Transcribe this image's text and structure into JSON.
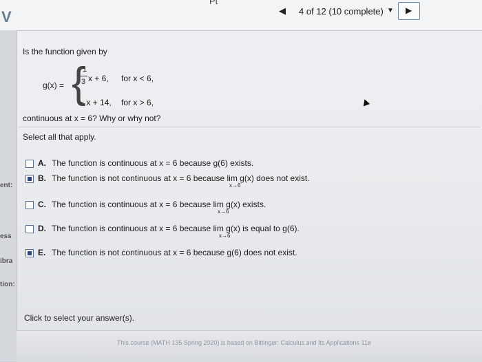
{
  "header": {
    "top_fragment": "Pt",
    "progress": "4 of 12 (10 complete)",
    "prev_icon": "triangle-left",
    "next_icon": "triangle-right",
    "caret_icon": "triangle-down"
  },
  "sidebar_fragments": [
    "ent:",
    "ess",
    "ibra",
    "tion:"
  ],
  "question": {
    "intro": "Is the function given by",
    "g_label": "g(x) =",
    "frac_num": "1",
    "frac_den": "3",
    "piece1_expr": "x + 6,",
    "piece1_cond": "for x < 6,",
    "piece2_expr": "− x + 14,",
    "piece2_cond": "for x > 6,",
    "outro": "continuous at x = 6? Why or why not?",
    "instruction": "Select all that apply."
  },
  "options": [
    {
      "letter": "A.",
      "text": "The function is continuous at x = 6 because g(6) exists.",
      "checked": false,
      "sub": ""
    },
    {
      "letter": "B.",
      "text": "The function is not continuous at x = 6 because  lim g(x) does not exist.",
      "checked": true,
      "sub": "x→6"
    },
    {
      "letter": "C.",
      "text": "The function is continuous at x = 6 because  lim g(x) exists.",
      "checked": false,
      "sub": "x→6"
    },
    {
      "letter": "D.",
      "text": "The function is continuous at x = 6 because  lim g(x) is equal to g(6).",
      "checked": false,
      "sub": "x→6"
    },
    {
      "letter": "E.",
      "text": "The function is not continuous at x = 6 because g(6) does not exist.",
      "checked": true,
      "sub": ""
    }
  ],
  "footer": {
    "select_answer": "Click to select your answer(s).",
    "course_note": "This course (MATH 135 Spring 2020) is based on Bittinger: Calculus and Its Applications 11e"
  }
}
